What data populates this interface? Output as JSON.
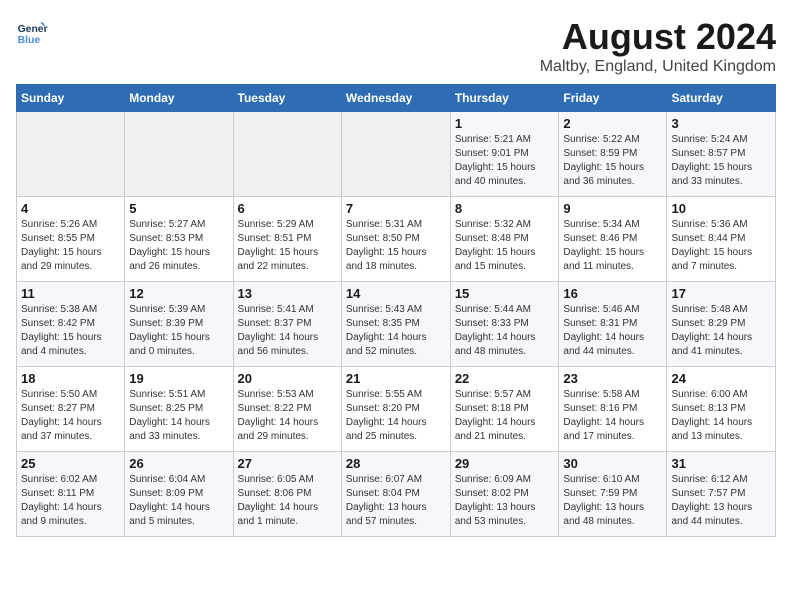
{
  "header": {
    "logo_line1": "General",
    "logo_line2": "Blue",
    "month_year": "August 2024",
    "location": "Maltby, England, United Kingdom"
  },
  "days_of_week": [
    "Sunday",
    "Monday",
    "Tuesday",
    "Wednesday",
    "Thursday",
    "Friday",
    "Saturday"
  ],
  "weeks": [
    [
      {
        "day": "",
        "info": ""
      },
      {
        "day": "",
        "info": ""
      },
      {
        "day": "",
        "info": ""
      },
      {
        "day": "",
        "info": ""
      },
      {
        "day": "1",
        "info": "Sunrise: 5:21 AM\nSunset: 9:01 PM\nDaylight: 15 hours\nand 40 minutes."
      },
      {
        "day": "2",
        "info": "Sunrise: 5:22 AM\nSunset: 8:59 PM\nDaylight: 15 hours\nand 36 minutes."
      },
      {
        "day": "3",
        "info": "Sunrise: 5:24 AM\nSunset: 8:57 PM\nDaylight: 15 hours\nand 33 minutes."
      }
    ],
    [
      {
        "day": "4",
        "info": "Sunrise: 5:26 AM\nSunset: 8:55 PM\nDaylight: 15 hours\nand 29 minutes."
      },
      {
        "day": "5",
        "info": "Sunrise: 5:27 AM\nSunset: 8:53 PM\nDaylight: 15 hours\nand 26 minutes."
      },
      {
        "day": "6",
        "info": "Sunrise: 5:29 AM\nSunset: 8:51 PM\nDaylight: 15 hours\nand 22 minutes."
      },
      {
        "day": "7",
        "info": "Sunrise: 5:31 AM\nSunset: 8:50 PM\nDaylight: 15 hours\nand 18 minutes."
      },
      {
        "day": "8",
        "info": "Sunrise: 5:32 AM\nSunset: 8:48 PM\nDaylight: 15 hours\nand 15 minutes."
      },
      {
        "day": "9",
        "info": "Sunrise: 5:34 AM\nSunset: 8:46 PM\nDaylight: 15 hours\nand 11 minutes."
      },
      {
        "day": "10",
        "info": "Sunrise: 5:36 AM\nSunset: 8:44 PM\nDaylight: 15 hours\nand 7 minutes."
      }
    ],
    [
      {
        "day": "11",
        "info": "Sunrise: 5:38 AM\nSunset: 8:42 PM\nDaylight: 15 hours\nand 4 minutes."
      },
      {
        "day": "12",
        "info": "Sunrise: 5:39 AM\nSunset: 8:39 PM\nDaylight: 15 hours\nand 0 minutes."
      },
      {
        "day": "13",
        "info": "Sunrise: 5:41 AM\nSunset: 8:37 PM\nDaylight: 14 hours\nand 56 minutes."
      },
      {
        "day": "14",
        "info": "Sunrise: 5:43 AM\nSunset: 8:35 PM\nDaylight: 14 hours\nand 52 minutes."
      },
      {
        "day": "15",
        "info": "Sunrise: 5:44 AM\nSunset: 8:33 PM\nDaylight: 14 hours\nand 48 minutes."
      },
      {
        "day": "16",
        "info": "Sunrise: 5:46 AM\nSunset: 8:31 PM\nDaylight: 14 hours\nand 44 minutes."
      },
      {
        "day": "17",
        "info": "Sunrise: 5:48 AM\nSunset: 8:29 PM\nDaylight: 14 hours\nand 41 minutes."
      }
    ],
    [
      {
        "day": "18",
        "info": "Sunrise: 5:50 AM\nSunset: 8:27 PM\nDaylight: 14 hours\nand 37 minutes."
      },
      {
        "day": "19",
        "info": "Sunrise: 5:51 AM\nSunset: 8:25 PM\nDaylight: 14 hours\nand 33 minutes."
      },
      {
        "day": "20",
        "info": "Sunrise: 5:53 AM\nSunset: 8:22 PM\nDaylight: 14 hours\nand 29 minutes."
      },
      {
        "day": "21",
        "info": "Sunrise: 5:55 AM\nSunset: 8:20 PM\nDaylight: 14 hours\nand 25 minutes."
      },
      {
        "day": "22",
        "info": "Sunrise: 5:57 AM\nSunset: 8:18 PM\nDaylight: 14 hours\nand 21 minutes."
      },
      {
        "day": "23",
        "info": "Sunrise: 5:58 AM\nSunset: 8:16 PM\nDaylight: 14 hours\nand 17 minutes."
      },
      {
        "day": "24",
        "info": "Sunrise: 6:00 AM\nSunset: 8:13 PM\nDaylight: 14 hours\nand 13 minutes."
      }
    ],
    [
      {
        "day": "25",
        "info": "Sunrise: 6:02 AM\nSunset: 8:11 PM\nDaylight: 14 hours\nand 9 minutes."
      },
      {
        "day": "26",
        "info": "Sunrise: 6:04 AM\nSunset: 8:09 PM\nDaylight: 14 hours\nand 5 minutes."
      },
      {
        "day": "27",
        "info": "Sunrise: 6:05 AM\nSunset: 8:06 PM\nDaylight: 14 hours\nand 1 minute."
      },
      {
        "day": "28",
        "info": "Sunrise: 6:07 AM\nSunset: 8:04 PM\nDaylight: 13 hours\nand 57 minutes."
      },
      {
        "day": "29",
        "info": "Sunrise: 6:09 AM\nSunset: 8:02 PM\nDaylight: 13 hours\nand 53 minutes."
      },
      {
        "day": "30",
        "info": "Sunrise: 6:10 AM\nSunset: 7:59 PM\nDaylight: 13 hours\nand 48 minutes."
      },
      {
        "day": "31",
        "info": "Sunrise: 6:12 AM\nSunset: 7:57 PM\nDaylight: 13 hours\nand 44 minutes."
      }
    ]
  ]
}
